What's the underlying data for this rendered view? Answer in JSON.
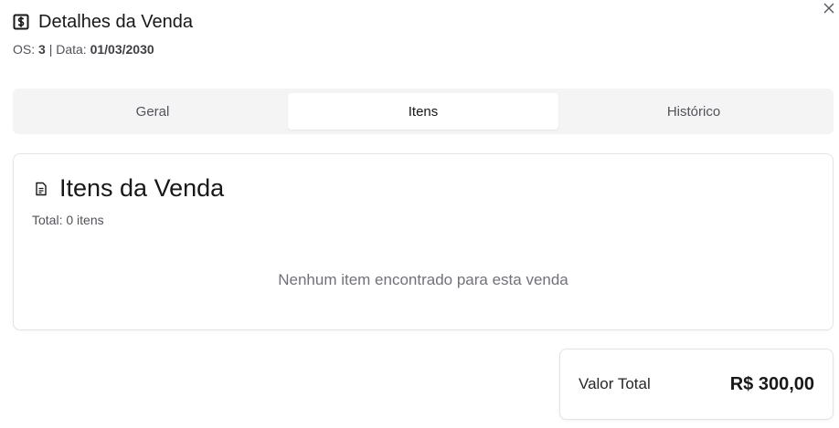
{
  "header": {
    "title": "Detalhes da Venda",
    "os_label": "OS: ",
    "os_value": "3",
    "separator": " | ",
    "date_label": "Data: ",
    "date_value": "01/03/2030",
    "icon": "dollar-sign-square-icon",
    "close_icon": "close-icon"
  },
  "tabs": [
    {
      "label": "Geral",
      "active": false
    },
    {
      "label": "Itens",
      "active": true
    },
    {
      "label": "Histórico",
      "active": false
    }
  ],
  "items_card": {
    "title": "Itens da Venda",
    "icon": "document-list-icon",
    "total_text": "Total: 0 itens",
    "empty_message": "Nenhum item encontrado para esta venda"
  },
  "summary": {
    "label": "Valor Total",
    "value": "R$ 300,00"
  }
}
